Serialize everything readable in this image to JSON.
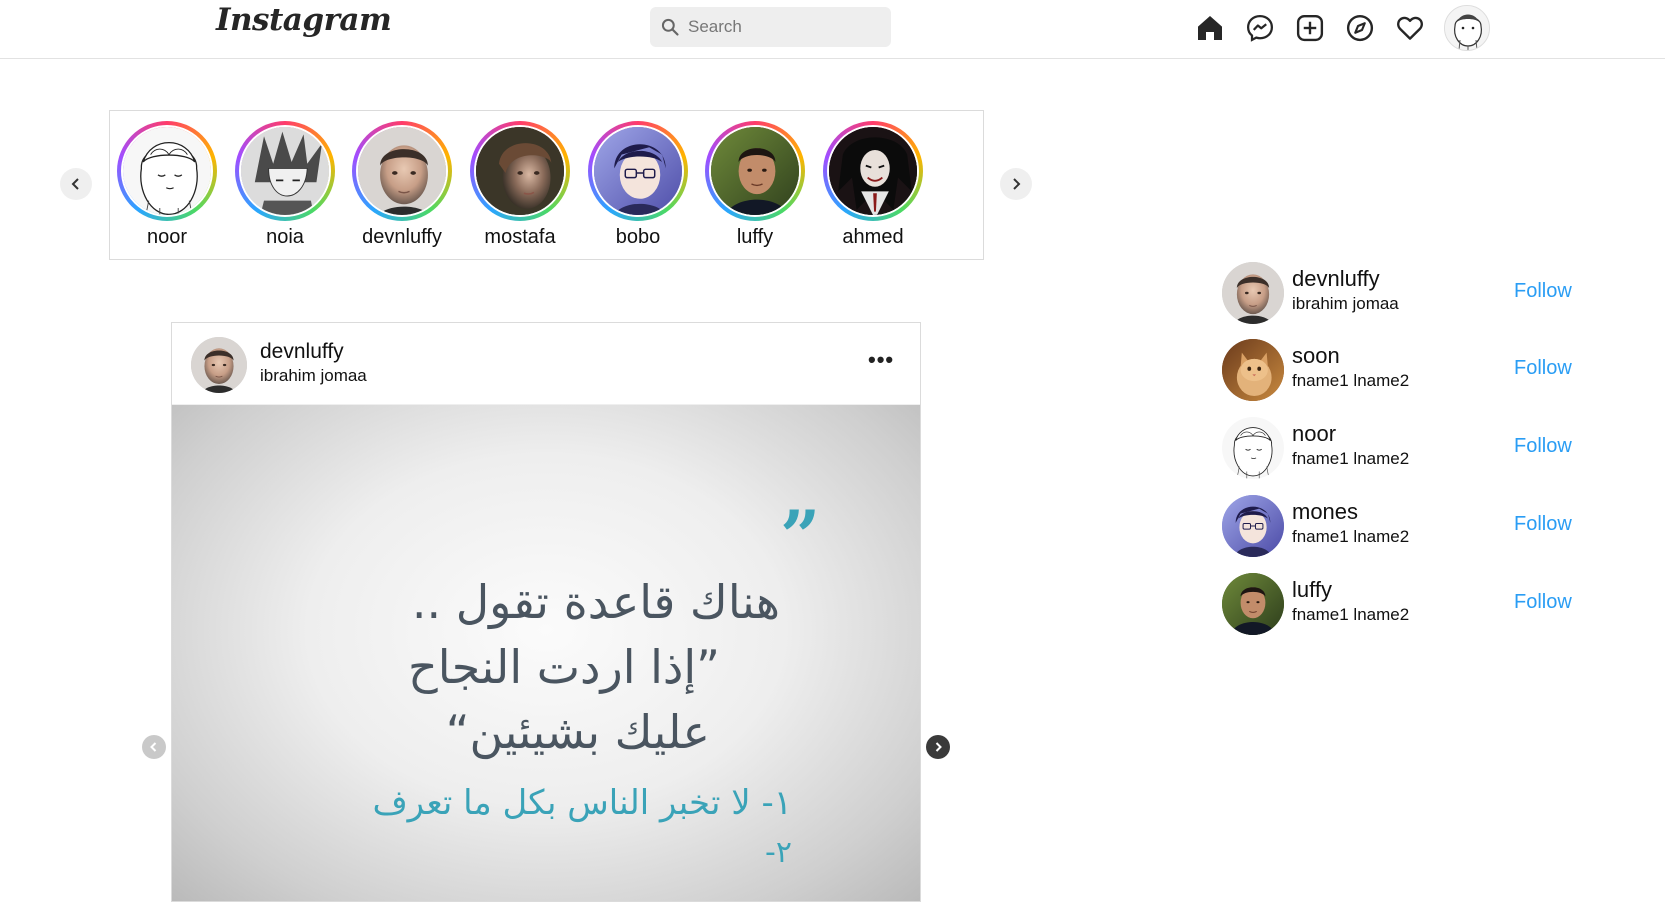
{
  "header": {
    "logo_text": "Instagram",
    "search_placeholder": "Search",
    "nav_icons": [
      "home-icon",
      "messenger-icon",
      "new-post-icon",
      "explore-icon",
      "activity-heart-icon",
      "profile-avatar"
    ]
  },
  "stories": [
    {
      "name": "noor",
      "avatar": "sketch"
    },
    {
      "name": "noia",
      "avatar": "anime-gray"
    },
    {
      "name": "devnluffy",
      "avatar": "face-light"
    },
    {
      "name": "mostafa",
      "avatar": "face-dark"
    },
    {
      "name": "bobo",
      "avatar": "anime-purple"
    },
    {
      "name": "luffy",
      "avatar": "face-green"
    },
    {
      "name": "ahmed",
      "avatar": "dark-art"
    }
  ],
  "post": {
    "username": "devnluffy",
    "fullname": "ibrahim jomaa",
    "more_label": "•••",
    "quote_mark": "”",
    "image_lines": [
      "هناك قاعدة تقول ..",
      "”إذا اردت النجاح",
      "عليك بشيئين“",
      "١- لا تخبر الناس بكل ما تعرف",
      "٢-"
    ]
  },
  "suggestions": [
    {
      "username": "devnluffy",
      "fullname": "ibrahim jomaa",
      "action": "Follow",
      "avatar": "face-light"
    },
    {
      "username": "soon",
      "fullname": "fname1 lname2",
      "action": "Follow",
      "avatar": "cat"
    },
    {
      "username": "noor",
      "fullname": "fname1 lname2",
      "action": "Follow",
      "avatar": "sketch"
    },
    {
      "username": "mones",
      "fullname": "fname1 lname2",
      "action": "Follow",
      "avatar": "anime-purple"
    },
    {
      "username": "luffy",
      "fullname": "fname1 lname2",
      "action": "Follow",
      "avatar": "face-green"
    }
  ],
  "colors": {
    "follow_blue": "#2a9df4",
    "story_ring": [
      "#ff3b6b",
      "#ffb400",
      "#4cd964",
      "#2aa5ff",
      "#a24dff"
    ],
    "quote_teal": "#3aa3b8"
  }
}
